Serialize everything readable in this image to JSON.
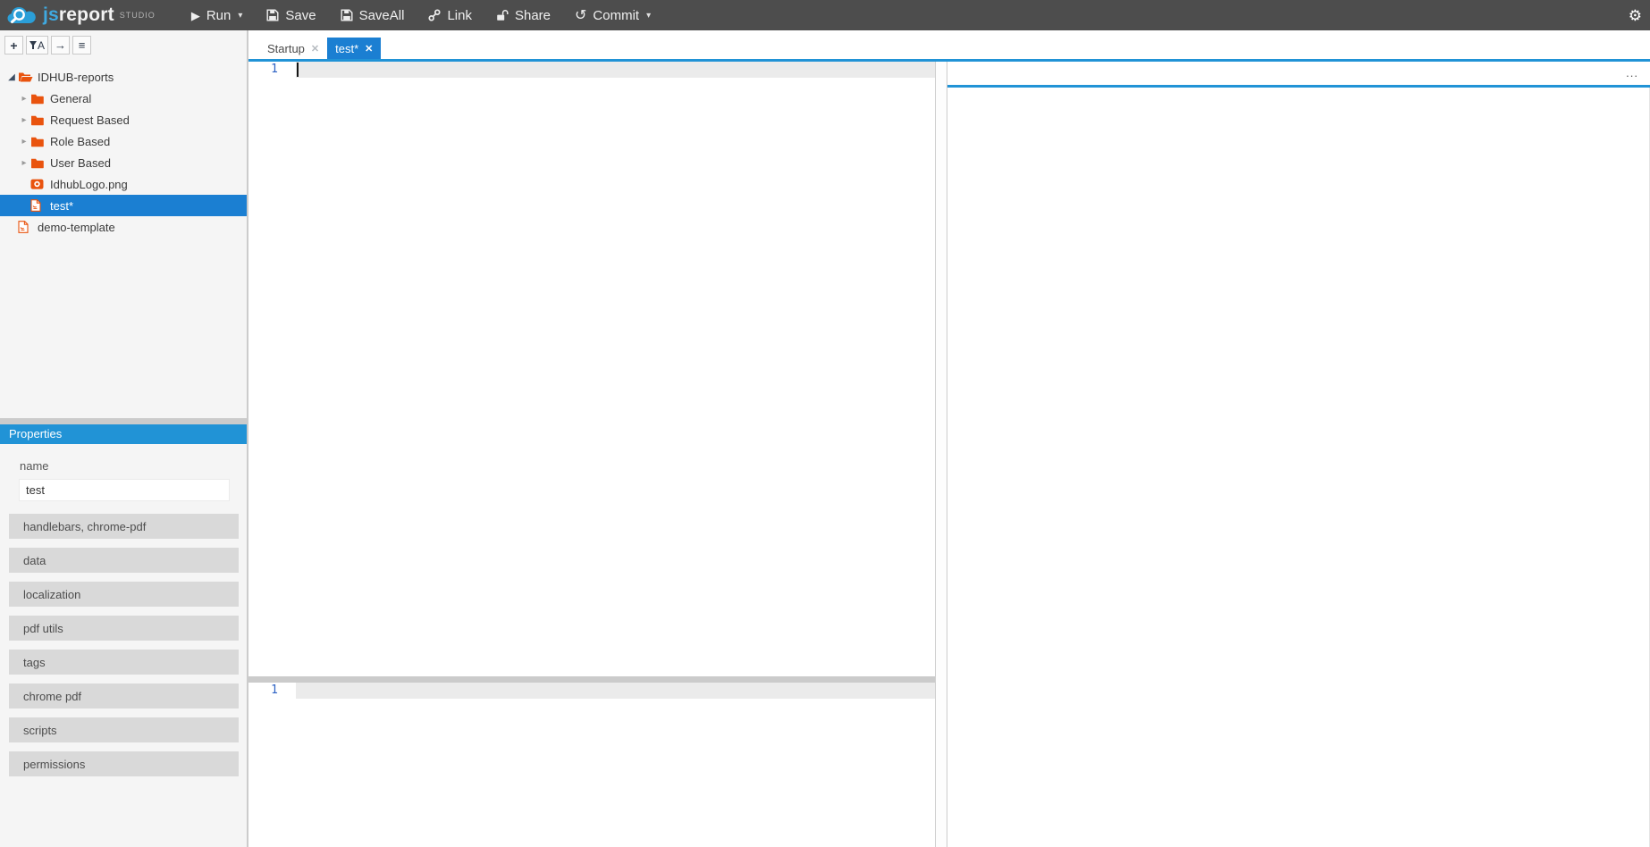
{
  "topbar": {
    "logo": {
      "js": "js",
      "report": "report",
      "studio": "STUDIO"
    },
    "buttons": [
      {
        "id": "run",
        "label": "Run",
        "icon": "play-icon",
        "has_caret": true
      },
      {
        "id": "save",
        "label": "Save",
        "icon": "floppy-icon",
        "has_caret": false
      },
      {
        "id": "saveall",
        "label": "SaveAll",
        "icon": "floppy-icon",
        "has_caret": false
      },
      {
        "id": "link",
        "label": "Link",
        "icon": "link-icon",
        "has_caret": false
      },
      {
        "id": "share",
        "label": "Share",
        "icon": "unlock-icon",
        "has_caret": false
      },
      {
        "id": "commit",
        "label": "Commit",
        "icon": "undo-icon",
        "has_caret": true
      }
    ],
    "settings_icon": "gear-icon"
  },
  "sidebar": {
    "toolbar_buttons": [
      {
        "id": "new-entity",
        "icon": "plus-icon"
      },
      {
        "id": "filter",
        "icon": "filter-name-icon"
      },
      {
        "id": "collapse",
        "icon": "arrow-right-icon"
      },
      {
        "id": "menu",
        "icon": "hamburger-icon"
      }
    ],
    "tree": [
      {
        "label": "IDHUB-reports",
        "icon": "folder-open-icon",
        "caret": "expanded",
        "depth": 0,
        "selected": false
      },
      {
        "label": "General",
        "icon": "folder-icon",
        "caret": "collapsed",
        "depth": 1,
        "selected": false
      },
      {
        "label": "Request Based",
        "icon": "folder-icon",
        "caret": "collapsed",
        "depth": 1,
        "selected": false
      },
      {
        "label": "Role Based",
        "icon": "folder-icon",
        "caret": "collapsed",
        "depth": 1,
        "selected": false
      },
      {
        "label": "User Based",
        "icon": "folder-icon",
        "caret": "collapsed",
        "depth": 1,
        "selected": false
      },
      {
        "label": "IdhubLogo.png",
        "icon": "image-icon",
        "caret": "none",
        "depth": 1,
        "selected": false
      },
      {
        "label": "test*",
        "icon": "file-icon",
        "caret": "none",
        "depth": 1,
        "selected": true
      },
      {
        "label": "demo-template",
        "icon": "file-icon",
        "caret": "none",
        "depth": 0,
        "selected": false
      }
    ],
    "properties": {
      "title": "Properties",
      "name_label": "name",
      "name_value": "test",
      "sections": [
        "handlebars, chrome-pdf",
        "data",
        "localization",
        "pdf utils",
        "tags",
        "chrome pdf",
        "scripts",
        "permissions"
      ]
    }
  },
  "editor": {
    "tabs": [
      {
        "label": "Startup",
        "active": false
      },
      {
        "label": "test*",
        "active": true
      }
    ],
    "main_editor": {
      "line_number": "1"
    },
    "secondary_editor": {
      "line_number": "1"
    }
  },
  "preview": {
    "menu_label": "..."
  },
  "colors": {
    "accent_blue": "#2193d6",
    "selection_blue": "#1b7fd2",
    "entity_orange": "#e9530e",
    "topbar_grey": "#4d4d4d"
  }
}
